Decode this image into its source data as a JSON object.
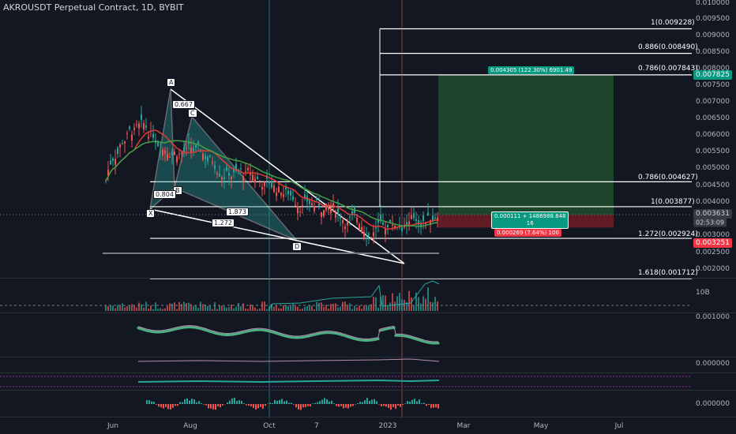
{
  "title": "AKROUSDT Perpetual Contract, 1D, BYBIT",
  "price_axis": {
    "ticks": [
      "0.010000",
      "0.009500",
      "0.009000",
      "0.008500",
      "0.008000",
      "0.007500",
      "0.007000",
      "0.006500",
      "0.006000",
      "0.005500",
      "0.005000",
      "0.004500",
      "0.004000",
      "0.003500",
      "0.003000",
      "0.002500",
      "0.002000"
    ],
    "tick_values": [
      0.01,
      0.0095,
      0.009,
      0.0085,
      0.008,
      0.0075,
      0.007,
      0.0065,
      0.006,
      0.0055,
      0.005,
      0.0045,
      0.004,
      0.0035,
      0.003,
      0.0025,
      0.002
    ],
    "target_tag": "0.007825",
    "current_tag": "0.003631",
    "countdown": "02:53:09",
    "stop_tag": "0.003251"
  },
  "fib_levels": [
    {
      "label": "1(0.009228)",
      "value": 0.009228
    },
    {
      "label": "0.886(0.008490)",
      "value": 0.00849
    },
    {
      "label": "0.786(0.007843)",
      "value": 0.007843
    },
    {
      "label": "0.786(0.004627)",
      "value": 0.004627
    },
    {
      "label": "1(0.003877)",
      "value": 0.003877
    },
    {
      "label": "1.272(0.002924)",
      "value": 0.002924
    },
    {
      "label": "1.618(0.001712)",
      "value": 0.001712
    }
  ],
  "pattern_points": [
    "X",
    "A",
    "B",
    "C",
    "D"
  ],
  "ratios": [
    "0.667",
    "0.804",
    "1.873",
    "1.272"
  ],
  "position": {
    "target_text": "0.004305 (122.30%) 6901.49",
    "entry_text_1": "0.000111 + 1486988.848",
    "entry_text_2": "16",
    "stop_text": "0.000269 (7.64%) 100"
  },
  "volume_label": "10B",
  "indicator_ticks": [
    "0.001000",
    "0.000000",
    "0.000000"
  ],
  "time_axis": [
    "Jun",
    "Aug",
    "Oct",
    "7",
    "2023",
    "Mar",
    "May",
    "Jul"
  ],
  "colors": {
    "up": "#26a69a",
    "down": "#ef5350",
    "bg": "#131722",
    "target": "#089981",
    "stop": "#f23645"
  }
}
